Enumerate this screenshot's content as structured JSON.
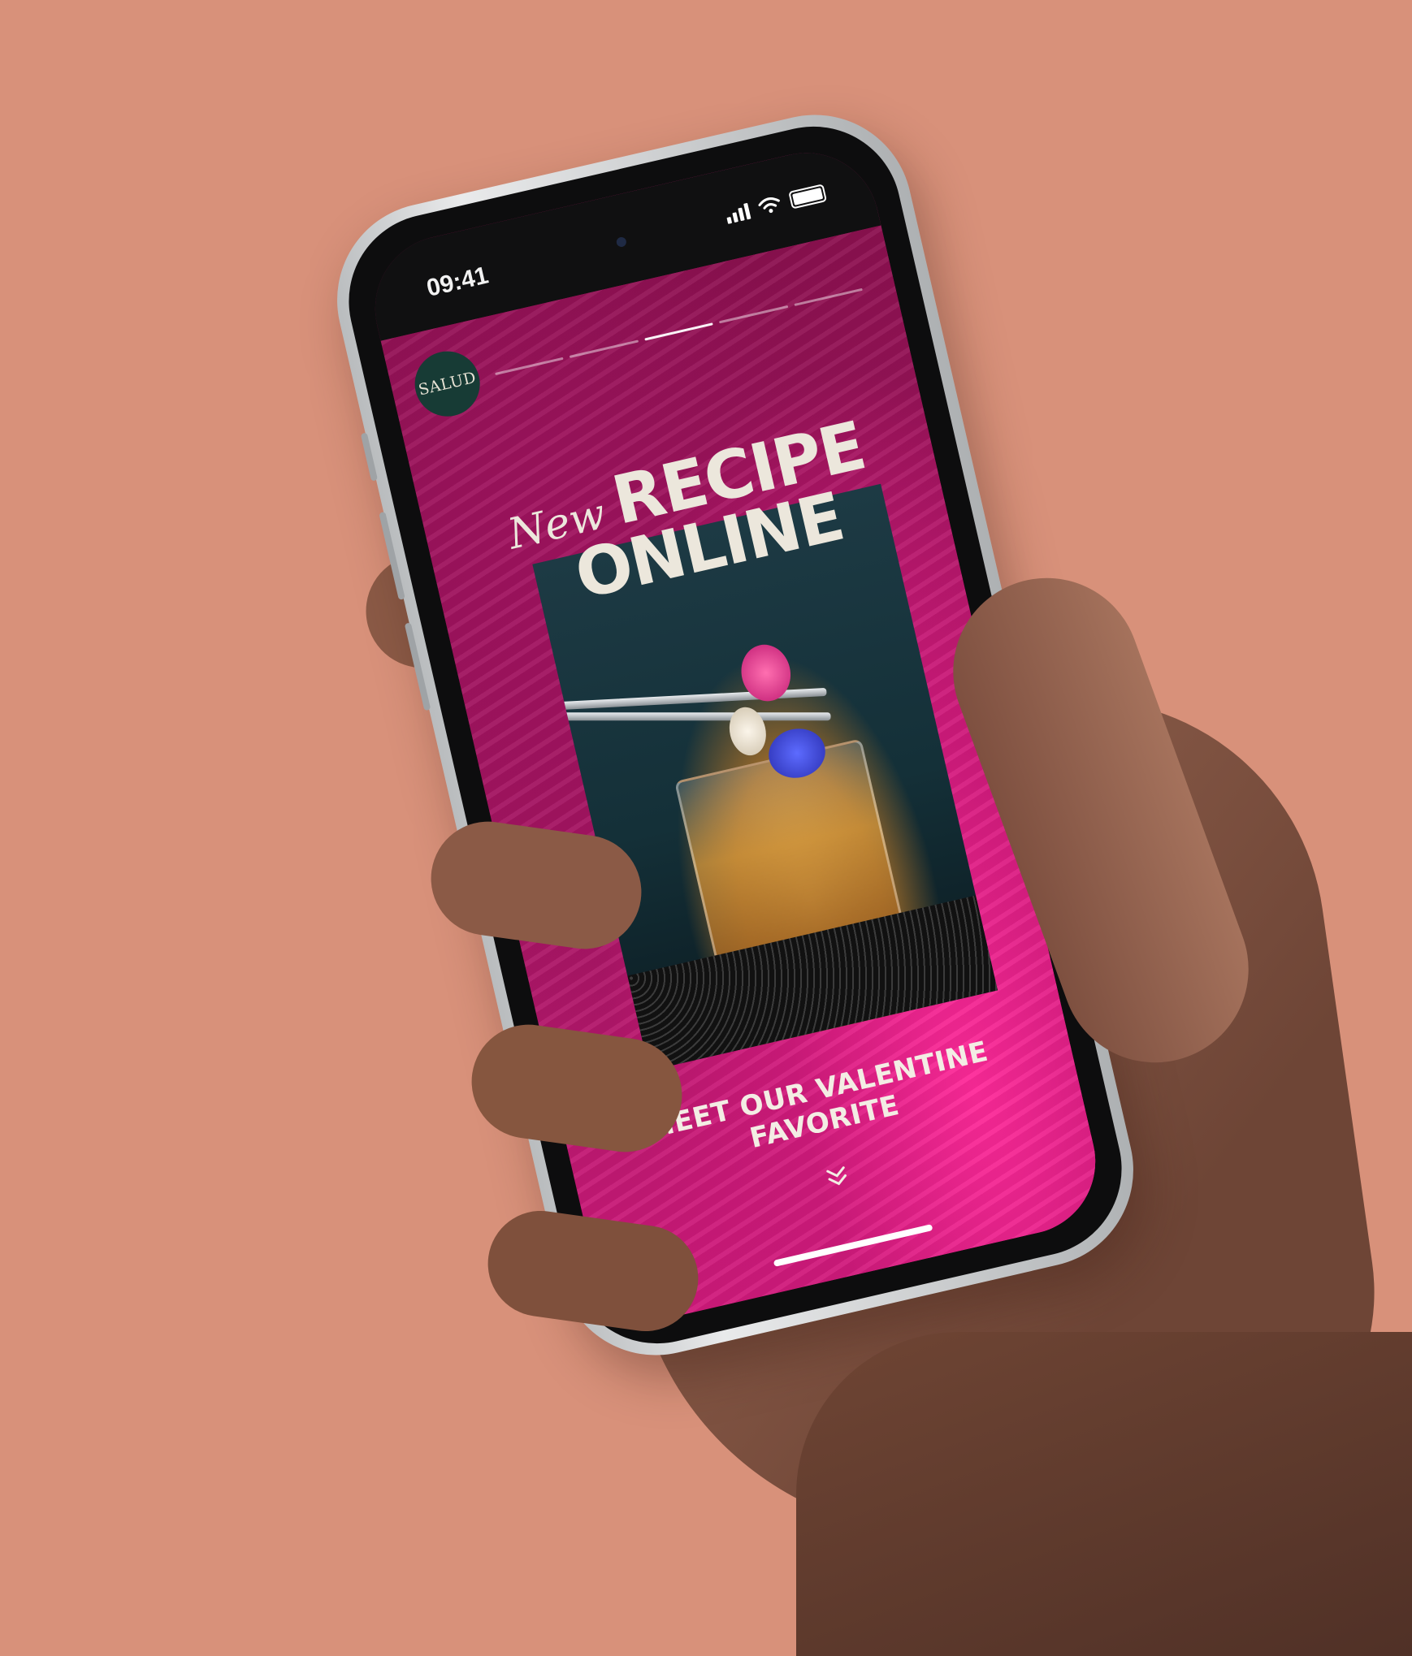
{
  "status_bar": {
    "time": "09:41"
  },
  "brand": {
    "logo_text": "SALUD"
  },
  "stories": {
    "count": 5,
    "active_index": 2
  },
  "hero": {
    "headline_script": "New",
    "headline_line1": "RECIPE",
    "headline_line2": "ONLINE",
    "subtitle_line1": "MEET OUR VALENTINE",
    "subtitle_line2": "FAVORITE"
  },
  "icons": {
    "scroll": "chevron-double-down-icon",
    "wifi": "wifi-icon",
    "signal": "signal-icon",
    "battery": "battery-icon"
  },
  "colors": {
    "background": "#d8917a",
    "logo_bg": "#173b35",
    "accent_pink": "#d11a7c",
    "headline_text": "#ece7dc"
  }
}
